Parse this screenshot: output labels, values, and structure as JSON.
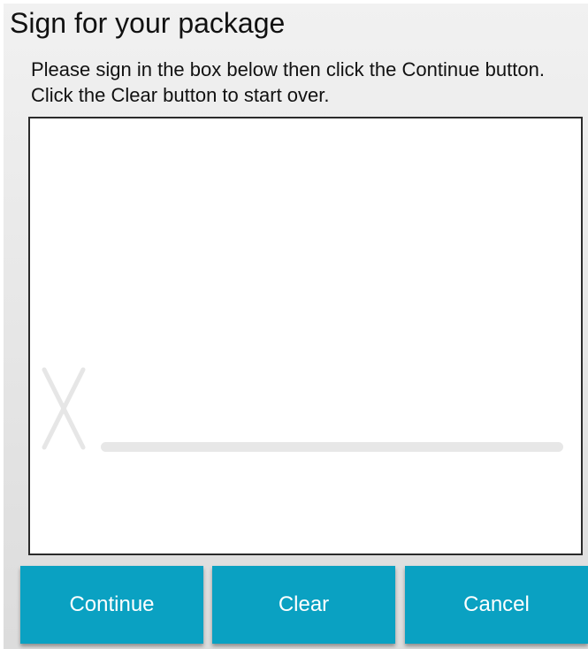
{
  "title": "Sign for your package",
  "instructions": "Please sign in the box below then click the Continue button. Click the Clear button to start over.",
  "signature": {
    "icon": "x-mark-icon"
  },
  "buttons": {
    "continue_label": "Continue",
    "clear_label": "Clear",
    "cancel_label": "Cancel"
  },
  "colors": {
    "button_bg": "#0aa1c2",
    "button_text": "#ffffff",
    "panel_bg": "#e6e6e6",
    "signature_guide": "#e7e7e7"
  }
}
